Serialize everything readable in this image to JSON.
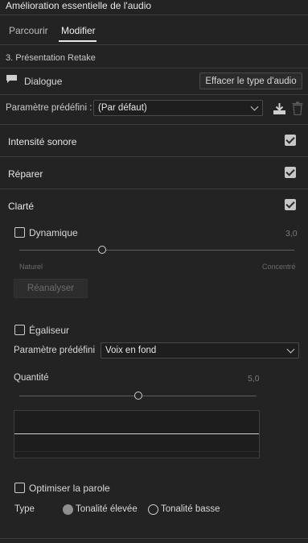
{
  "panel": {
    "title": "Amélioration essentielle de l'audio"
  },
  "tabs": [
    {
      "label": "Parcourir",
      "active": false
    },
    {
      "label": "Modifier",
      "active": true
    }
  ],
  "clip": {
    "name": "3. Présentation Retake"
  },
  "audio_type": {
    "label": "Dialogue",
    "icon": "speech-bubble-icon",
    "clear_button": "Effacer le type d'audio"
  },
  "preset": {
    "label": "Paramètre prédéfini :",
    "value": "(Par défaut)",
    "save_icon": "save-preset-icon",
    "delete_icon": "trash-icon"
  },
  "sections": {
    "loudness": {
      "label": "Intensité sonore",
      "checked": true
    },
    "repair": {
      "label": "Réparer",
      "checked": true
    },
    "clarity": {
      "label": "Clarté",
      "checked": true
    }
  },
  "dynamics": {
    "label": "Dynamique",
    "checked": false,
    "value": "3,0",
    "level": 0.3,
    "min_label": "Naturel",
    "max_label": "Concentré",
    "reanalyze_button": "Réanalyser"
  },
  "equalizer": {
    "label": "Égaliseur",
    "checked": false,
    "preset_label": "Paramètre prédéfini",
    "preset_value": "Voix en fond",
    "amount_label": "Quantité",
    "amount_value": "5,0",
    "amount_level": 0.5
  },
  "speech": {
    "label": "Optimiser la parole",
    "checked": false,
    "type_label": "Type",
    "options": [
      {
        "label": "Tonalité élevée",
        "selected": true
      },
      {
        "label": "Tonalité basse",
        "selected": false
      }
    ]
  },
  "colors": {
    "background": "#232323",
    "text": "#d6d6d6",
    "checkbox": "#c7c7c7"
  }
}
